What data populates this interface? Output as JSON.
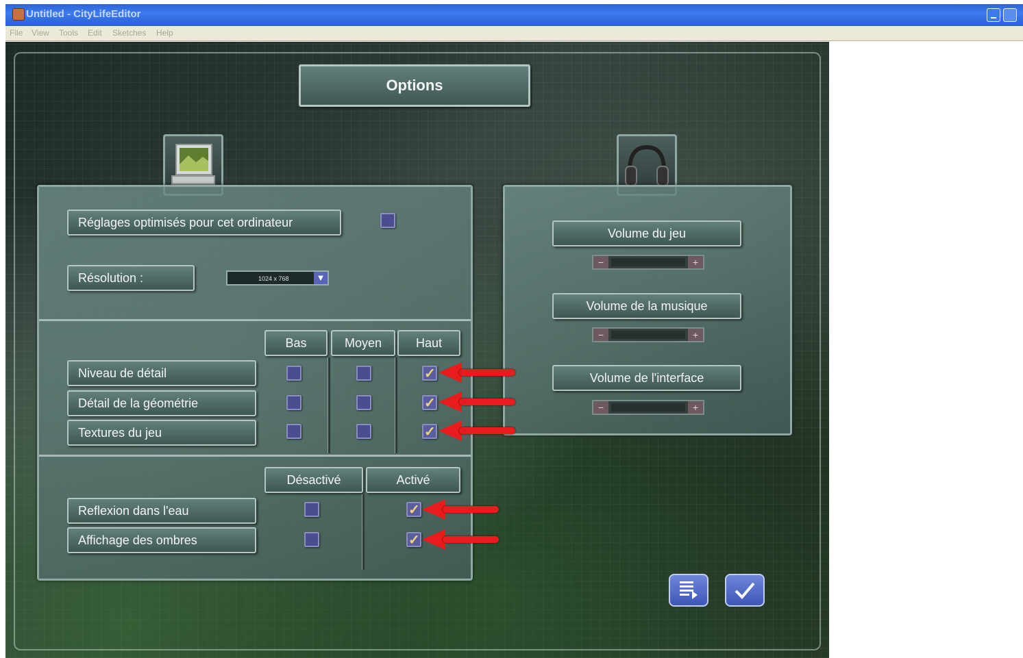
{
  "window": {
    "title": "Untitled - CityLifeEditor",
    "menu": [
      "File",
      "View",
      "Tools",
      "Edit",
      "Sketches",
      "Help"
    ]
  },
  "options": {
    "title": "Options",
    "optimized_label": "Réglages optimisés pour cet ordinateur",
    "optimized_checked": false,
    "resolution_label": "Résolution :",
    "resolution_value": "1024 x 768",
    "quality_columns": [
      "Bas",
      "Moyen",
      "Haut"
    ],
    "quality_rows": [
      {
        "label": "Niveau de détail",
        "selected": "Haut"
      },
      {
        "label": "Détail de la géométrie",
        "selected": "Haut"
      },
      {
        "label": "Textures du jeu",
        "selected": "Haut"
      }
    ],
    "toggle_columns": [
      "Désactivé",
      "Activé"
    ],
    "toggle_rows": [
      {
        "label": "Reflexion dans l'eau",
        "selected": "Activé"
      },
      {
        "label": "Affichage des ombres",
        "selected": "Activé"
      }
    ]
  },
  "audio": {
    "game_volume_label": "Volume du jeu",
    "music_volume_label": "Volume de la musique",
    "interface_volume_label": "Volume de l'interface",
    "minus_glyph": "−",
    "plus_glyph": "+"
  },
  "icons": {
    "display": "monitor-icon",
    "audio": "headphones-icon",
    "dropdown": "chevron-down-icon",
    "details": "notes-icon",
    "confirm": "check-icon"
  },
  "colors": {
    "annotation_arrow": "#e81c1c",
    "checkbox": "#4a4d8f",
    "check_mark": "#f0d47a"
  }
}
